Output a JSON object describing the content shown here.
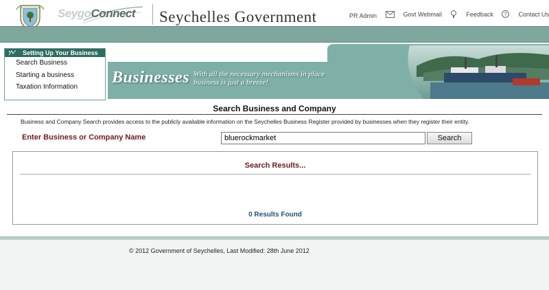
{
  "header": {
    "logo_text_1": "Seygo",
    "logo_text_2": "Connect",
    "site_title": "Seychelles Government",
    "links": {
      "pr_admin": "PR Admin",
      "govt_webmail": "Govt Webmail",
      "feedback": "Feedback",
      "contact_us": "Contact Us"
    }
  },
  "sidebar": {
    "heading": "Setting Up Your Business",
    "items": [
      {
        "label": "Search Business"
      },
      {
        "label": "Starting a business"
      },
      {
        "label": "Taxation Information"
      }
    ]
  },
  "banner": {
    "title": "Businesses",
    "subtitle_line1": "With all the necessary mechanisms in place",
    "subtitle_line2": "business is just a breeze!"
  },
  "main": {
    "heading": "Search Business and Company",
    "description": "Business and Company Search provides access to the publicly available information on the Seychelles Business Register provided by businesses when they register their entity.",
    "input_label": "Enter Business or Company Name",
    "input_value": "bluerockmarket",
    "search_button": "Search",
    "results_title": "Search Results...",
    "results_count": "0 Results Found"
  },
  "footer": {
    "text": "© 2012 Government of Seychelles, Last Modified: 28th June 2012"
  },
  "colors": {
    "band": "#7fa79e",
    "menu_header": "#2d6d62",
    "label_red": "#6b1c1c",
    "count_blue": "#1f4f7a"
  }
}
